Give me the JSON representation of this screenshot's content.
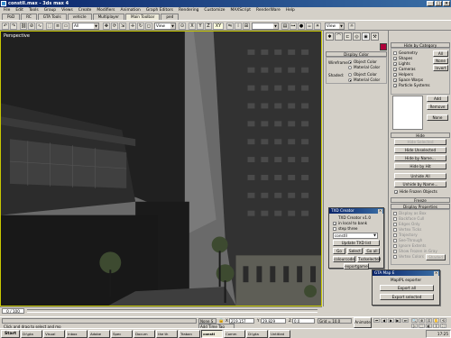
{
  "window": {
    "title": "constII.max - 3ds max 4"
  },
  "menu": [
    "File",
    "Edit",
    "Tools",
    "Group",
    "Views",
    "Create",
    "Modifiers",
    "Animation",
    "Graph Editors",
    "Rendering",
    "Customize",
    "MAXScript",
    "RenderWare",
    "Help"
  ],
  "tabs": [
    {
      "label": "PoD",
      "active": false
    },
    {
      "label": "RC",
      "active": false
    },
    {
      "label": "GTA Tools",
      "active": false
    },
    {
      "label": "vehicle",
      "active": false
    },
    {
      "label": "Multiplayer",
      "active": false
    },
    {
      "label": "Main Toolbar",
      "active": true
    },
    {
      "label": "ped",
      "active": false
    }
  ],
  "toolbar": {
    "selection_filter": "All",
    "ref_coord": "View",
    "named_selection": "",
    "view_dropdown": "View"
  },
  "viewport": {
    "label": "Perspective"
  },
  "command_panel": {
    "display_color": {
      "header": "Display Color",
      "wireframe_label": "Wireframe:",
      "shaded_label": "Shaded:",
      "object_color": "Object Color",
      "material_color": "Material Color"
    }
  },
  "hide_by_category": {
    "header": "Hide by Category",
    "items": [
      {
        "label": "Geometry",
        "checked": false
      },
      {
        "label": "Shapes",
        "checked": true
      },
      {
        "label": "Lights",
        "checked": true
      },
      {
        "label": "Cameras",
        "checked": true
      },
      {
        "label": "Helpers",
        "checked": true
      },
      {
        "label": "Space Warps",
        "checked": true
      },
      {
        "label": "Particle Systems",
        "checked": true
      }
    ],
    "buttons": {
      "all": "All",
      "none": "None",
      "invert": "Invert",
      "add": "Add",
      "remove": "Remove",
      "list_none": "None"
    }
  },
  "hide": {
    "header": "Hide",
    "buttons": [
      "Hide Selected",
      "Hide Unselected",
      "Hide by Name...",
      "Hide by Hit",
      "Unhide All",
      "Unhide by Name..."
    ],
    "hide_frozen": "Hide Frozen Objects"
  },
  "freeze": {
    "header": "Freeze"
  },
  "display_properties": {
    "header": "Display Properties",
    "items": [
      "Display as Box",
      "Backface Cull",
      "Edges Only",
      "Vertex Ticks",
      "Trajectory",
      "See-Through",
      "Ignore Extents",
      "Show Frozen in Gray",
      "Vertex Colors",
      "Shaded"
    ]
  },
  "txd_dialog": {
    "title": "TXD Creator",
    "group": "TXD Creator v1.0",
    "in_local": "in local to bank",
    "step_three": "step three",
    "input_value": "constII",
    "update_btn": "Update TXD list",
    "go": "Go",
    "select": "Select",
    "go_all": "Go all",
    "colourcode": "colourcode",
    "txd_selected": "Txdselected",
    "export_game": "exportgame"
  },
  "map_dialog": {
    "title": "GTA Map E",
    "group": "MapIPL exporter",
    "export_all": "Export all",
    "export_selected": "Export selected"
  },
  "timeline": {
    "frame": "0 / 100"
  },
  "status": {
    "selection": "None S",
    "x_value": "219.157",
    "y_value": "29.829",
    "z_value": "0.0",
    "grid": "Grid = 10.0",
    "prompt": "Click and drag to select and mo",
    "add_time_tag": "Add Time Tag",
    "animate": "Animate"
  },
  "taskbar": {
    "start": "Start",
    "items": [
      "D:\\gta",
      "Visual",
      "Inbox",
      "Adobe",
      "Spec",
      "Docum",
      "the th",
      "Traban",
      "constI",
      "Comm",
      "D:\\gta",
      "Untitled"
    ],
    "clock": "17:25"
  }
}
